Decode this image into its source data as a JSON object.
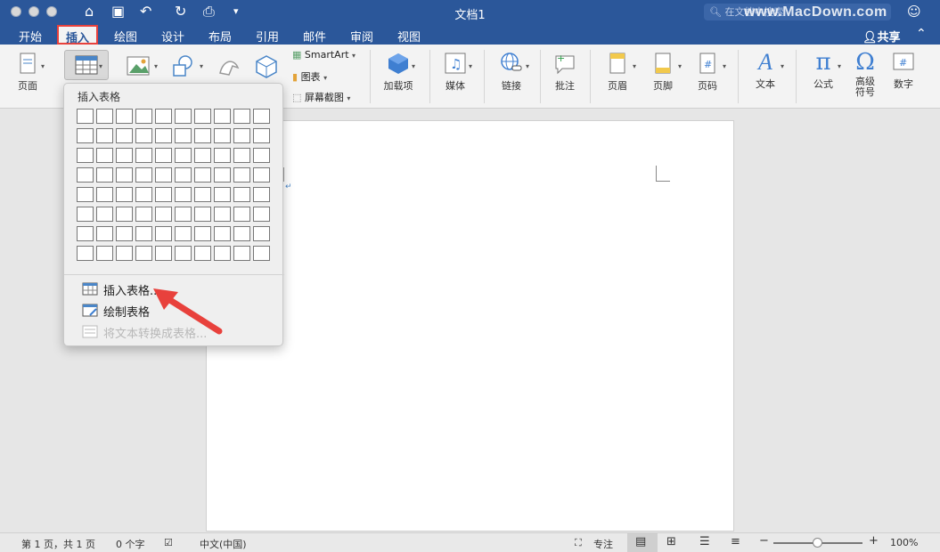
{
  "window": {
    "title": "文档1",
    "search_placeholder": "在文档中搜索",
    "watermark": "www.MacDown.com"
  },
  "tabs": [
    {
      "label": "开始"
    },
    {
      "label": "插入",
      "active": true
    },
    {
      "label": "绘图"
    },
    {
      "label": "设计"
    },
    {
      "label": "布局"
    },
    {
      "label": "引用"
    },
    {
      "label": "邮件"
    },
    {
      "label": "审阅"
    },
    {
      "label": "视图"
    }
  ],
  "share_label": "共享",
  "ribbon": {
    "pages": "页面",
    "smartart": "SmartArt",
    "chart": "图表",
    "screenshot": "屏幕截图",
    "addins": "加载项",
    "media": "媒体",
    "link": "链接",
    "comment": "批注",
    "header": "页眉",
    "footer": "页脚",
    "page_number": "页码",
    "text": "文本",
    "equation": "公式",
    "symbol_line1": "高级",
    "symbol_line2": "符号",
    "number": "数字"
  },
  "table_menu": {
    "title": "插入表格",
    "rows": 8,
    "cols": 10,
    "items": [
      {
        "label": "插入表格...",
        "enabled": true
      },
      {
        "label": "绘制表格",
        "enabled": true
      },
      {
        "label": "将文本转换成表格...",
        "enabled": false
      }
    ]
  },
  "status": {
    "page": "第 1 页，共 1 页",
    "words": "0 个字",
    "language": "中文(中国)",
    "focus": "专注",
    "zoom": "100%",
    "zoom_percent": 100
  },
  "colors": {
    "accent": "#2b579a",
    "highlight": "#e8413c"
  },
  "icons": [
    "home-icon",
    "save-icon",
    "undo-icon",
    "redo-icon",
    "print-icon",
    "table-icon",
    "share-icon"
  ]
}
